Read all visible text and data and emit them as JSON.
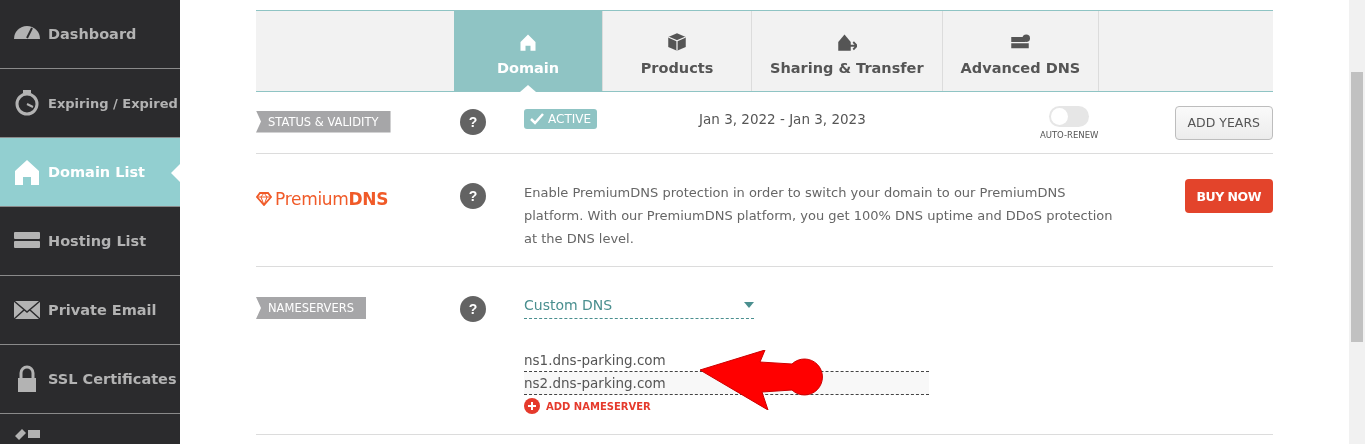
{
  "sidebar": {
    "items": [
      {
        "label": "Dashboard",
        "selected": false
      },
      {
        "label": "Expiring / Expired",
        "selected": false
      },
      {
        "label": "Domain List",
        "selected": true
      },
      {
        "label": "Hosting List",
        "selected": false
      },
      {
        "label": "Private Email",
        "selected": false
      },
      {
        "label": "SSL Certificates",
        "selected": false
      }
    ]
  },
  "tabs": [
    {
      "label": "Domain",
      "selected": true
    },
    {
      "label": "Products",
      "selected": false
    },
    {
      "label": "Sharing & Transfer",
      "selected": false
    },
    {
      "label": "Advanced DNS",
      "selected": false
    }
  ],
  "status": {
    "label": "STATUS & VALIDITY",
    "help": "?",
    "badge": "ACTIVE",
    "dates": "Jan 3, 2022 - Jan 3, 2023",
    "auto_renew": {
      "label": "AUTO-RENEW",
      "on": false
    },
    "button": "ADD YEARS"
  },
  "premium_dns": {
    "help": "?",
    "logo_light": "Premium",
    "logo_bold": "DNS",
    "text": "Enable PremiumDNS protection in order to switch your domain to our PremiumDNS platform. With our PremiumDNS platform, you get 100% DNS uptime and DDoS protection at the DNS level.",
    "button": "BUY NOW"
  },
  "nameservers": {
    "label": "NAMESERVERS",
    "help": "?",
    "select": "Custom DNS",
    "entries": [
      "ns1.dns-parking.com",
      "ns2.dns-parking.com"
    ],
    "add": "ADD NAMESERVER"
  }
}
